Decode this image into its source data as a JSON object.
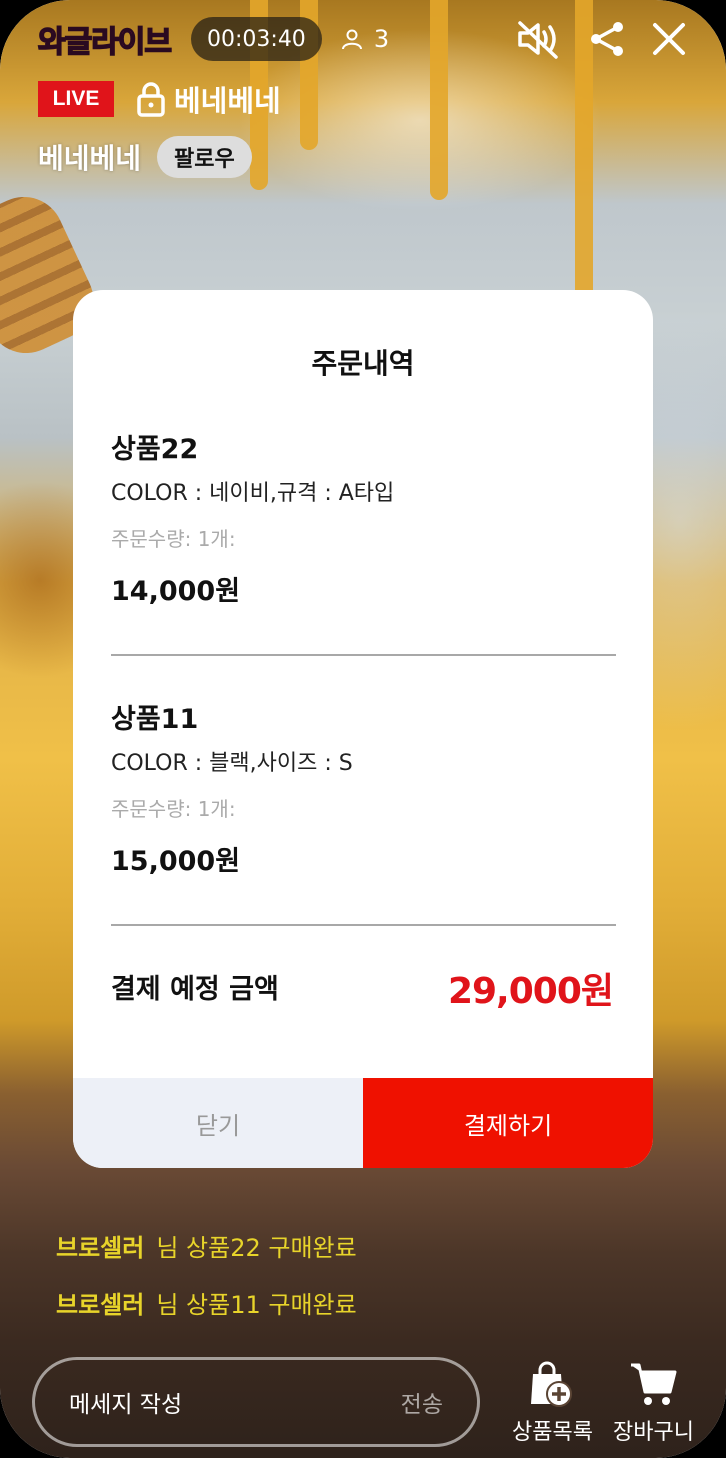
{
  "header": {
    "logo_text": "와글라이브",
    "timer": "00:03:40",
    "viewer_count": "3",
    "live_label": "LIVE",
    "room_name": "베네베네",
    "seller_name": "베네베네",
    "follow_label": "팔로우"
  },
  "modal": {
    "title": "주문내역",
    "items": [
      {
        "name": "상품22",
        "options": "COLOR : 네이비,규격 : A타입",
        "quantity": "주문수량: 1개:",
        "price": "14,000원"
      },
      {
        "name": "상품11",
        "options": "COLOR : 블랙,사이즈 : S",
        "quantity": "주문수량: 1개:",
        "price": "15,000원"
      }
    ],
    "total_label": "결제 예정 금액",
    "total_value": "29,000원",
    "close_label": "닫기",
    "pay_label": "결제하기"
  },
  "chat": [
    {
      "nick": "브로셀러",
      "message": "님 상품22 구매완료"
    },
    {
      "nick": "브로셀러",
      "message": "님 상품11 구매완료"
    }
  ],
  "footer": {
    "message_placeholder": "메세지 작성",
    "send_label": "전송",
    "product_list_label": "상품목록",
    "cart_label": "장바구니"
  },
  "colors": {
    "accent_red": "#e0141a",
    "pay_button": "#ef1100",
    "chat_highlight": "#e8d42a",
    "logo_pink": "#e6257c"
  },
  "icons": {
    "viewer": "person-icon",
    "mute": "speaker-muted-icon",
    "share": "share-icon",
    "close": "close-icon",
    "lock": "lock-icon",
    "product_list": "shopping-bag-plus-icon",
    "cart": "cart-icon"
  }
}
